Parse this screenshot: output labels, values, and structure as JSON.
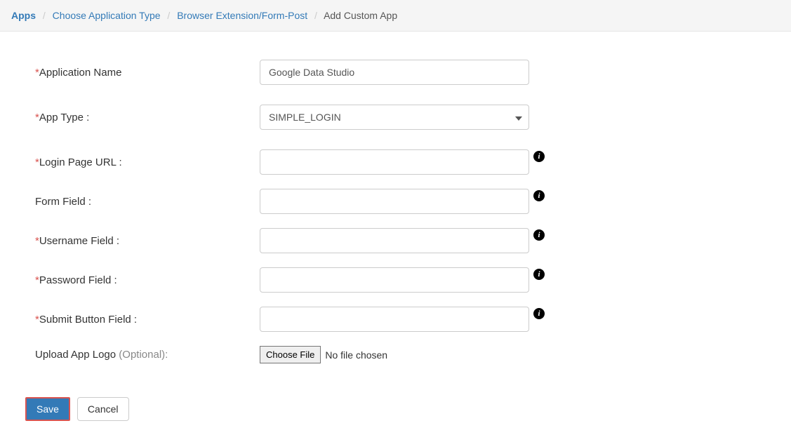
{
  "breadcrumb": {
    "items": [
      {
        "label": "Apps"
      },
      {
        "label": "Choose Application Type"
      },
      {
        "label": "Browser Extension/Form-Post"
      }
    ],
    "current": "Add Custom App"
  },
  "form": {
    "appName": {
      "label": "Application Name",
      "value": "Google Data Studio",
      "required": true
    },
    "appType": {
      "label": "App Type :",
      "value": "SIMPLE_LOGIN",
      "required": true
    },
    "loginUrl": {
      "label": "Login Page URL :",
      "value": "",
      "required": true
    },
    "formField": {
      "label": "Form Field :",
      "value": "",
      "required": false
    },
    "usernameField": {
      "label": "Username Field :",
      "value": "",
      "required": true
    },
    "passwordField": {
      "label": "Password Field :",
      "value": "",
      "required": true
    },
    "submitField": {
      "label": "Submit Button Field :",
      "value": "",
      "required": true
    },
    "uploadLogo": {
      "label": "Upload App Logo ",
      "optional": "(Optional):",
      "button": "Choose File",
      "status": "No file chosen"
    }
  },
  "buttons": {
    "save": "Save",
    "cancel": "Cancel"
  },
  "glyphs": {
    "info": "i",
    "asterisk": "*",
    "sep": "/"
  }
}
